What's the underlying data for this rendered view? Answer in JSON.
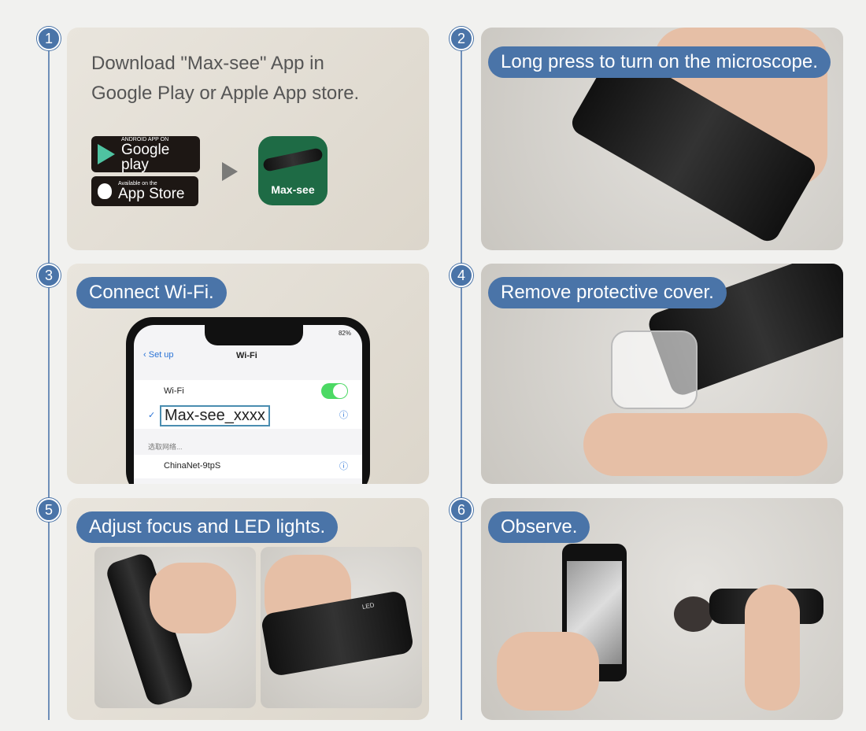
{
  "steps": [
    {
      "number": "1",
      "text_line1": "Download \"Max-see\" App in",
      "text_line2": "Google Play or Apple App store."
    },
    {
      "number": "2",
      "label": "Long press to turn on the microscope."
    },
    {
      "number": "3",
      "label": "Connect Wi-Fi."
    },
    {
      "number": "4",
      "label": "Remove protective cover."
    },
    {
      "number": "5",
      "label": "Adjust focus and LED lights."
    },
    {
      "number": "6",
      "label": "Observe."
    }
  ],
  "store_badges": {
    "google_small": "ANDROID APP ON",
    "google_big": "Google play",
    "apple_small": "Available on the",
    "apple_big": "App Store"
  },
  "app_icon": {
    "label": "Max-see",
    "color": "#1e6b45"
  },
  "phone": {
    "status": "82%",
    "back": "Set up",
    "title": "Wi-Fi",
    "wifi_label": "Wi-Fi",
    "network": "Max-see_xxxx",
    "section": "选取网络...",
    "other_network": "ChinaNet-9tpS"
  },
  "device_label": "LED",
  "colors": {
    "accent": "#4a74a8",
    "background": "#f1f1ef"
  }
}
